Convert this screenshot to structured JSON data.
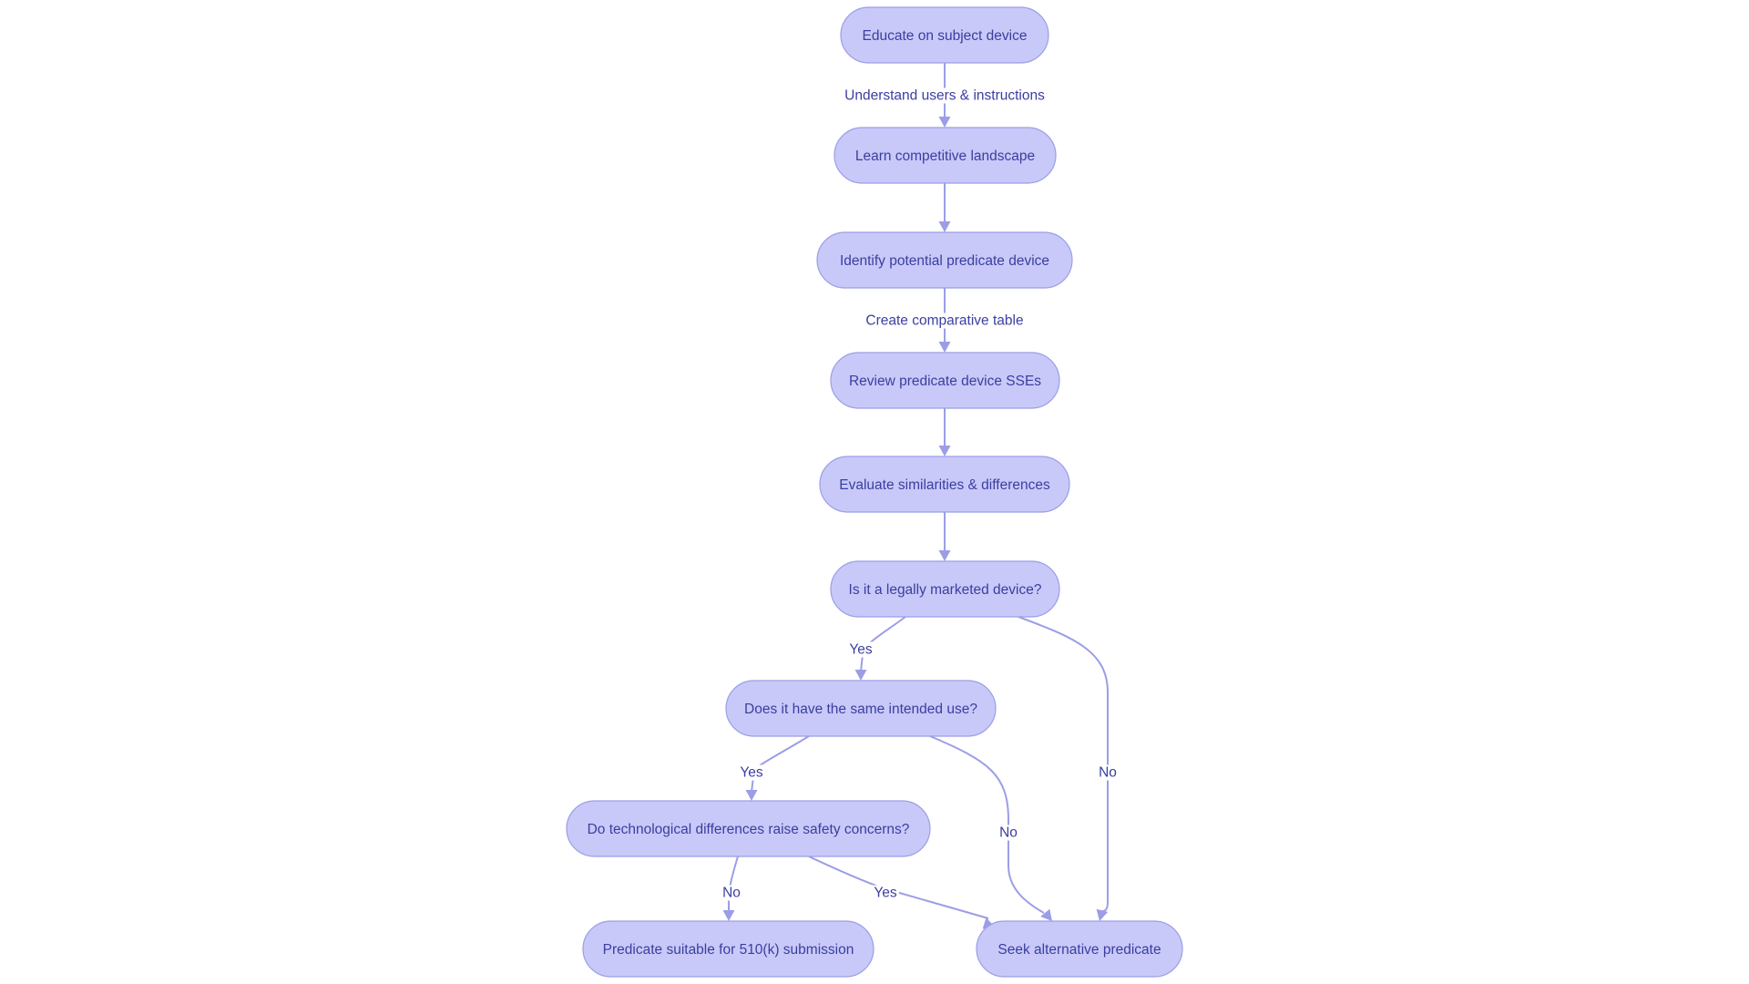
{
  "diagram": {
    "type": "flowchart",
    "nodes": [
      {
        "id": "educate",
        "label": "Educate on subject device"
      },
      {
        "id": "learn",
        "label": "Learn competitive landscape"
      },
      {
        "id": "identify",
        "label": "Identify potential predicate device"
      },
      {
        "id": "review",
        "label": "Review predicate device SSEs"
      },
      {
        "id": "evaluate",
        "label": "Evaluate similarities & differences"
      },
      {
        "id": "legal",
        "label": "Is it a legally marketed device?"
      },
      {
        "id": "intended",
        "label": "Does it have the same intended use?"
      },
      {
        "id": "tech",
        "label": "Do technological differences raise safety concerns?"
      },
      {
        "id": "suitable",
        "label": "Predicate suitable for 510(k) submission"
      },
      {
        "id": "seek",
        "label": "Seek alternative predicate"
      }
    ],
    "edges": [
      {
        "from": "educate",
        "to": "learn",
        "label": "Understand users & instructions"
      },
      {
        "from": "learn",
        "to": "identify",
        "label": ""
      },
      {
        "from": "identify",
        "to": "review",
        "label": "Create comparative table"
      },
      {
        "from": "review",
        "to": "evaluate",
        "label": ""
      },
      {
        "from": "evaluate",
        "to": "legal",
        "label": ""
      },
      {
        "from": "legal",
        "to": "intended",
        "label": "Yes"
      },
      {
        "from": "legal",
        "to": "seek",
        "label": "No"
      },
      {
        "from": "intended",
        "to": "tech",
        "label": "Yes"
      },
      {
        "from": "intended",
        "to": "seek",
        "label": "No"
      },
      {
        "from": "tech",
        "to": "suitable",
        "label": "No"
      },
      {
        "from": "tech",
        "to": "seek",
        "label": "Yes"
      }
    ],
    "colors": {
      "node_fill": "#c8c9f8",
      "node_stroke": "#9b9ee6",
      "text": "#3a3ea0",
      "edge": "#9b9ee6"
    }
  }
}
